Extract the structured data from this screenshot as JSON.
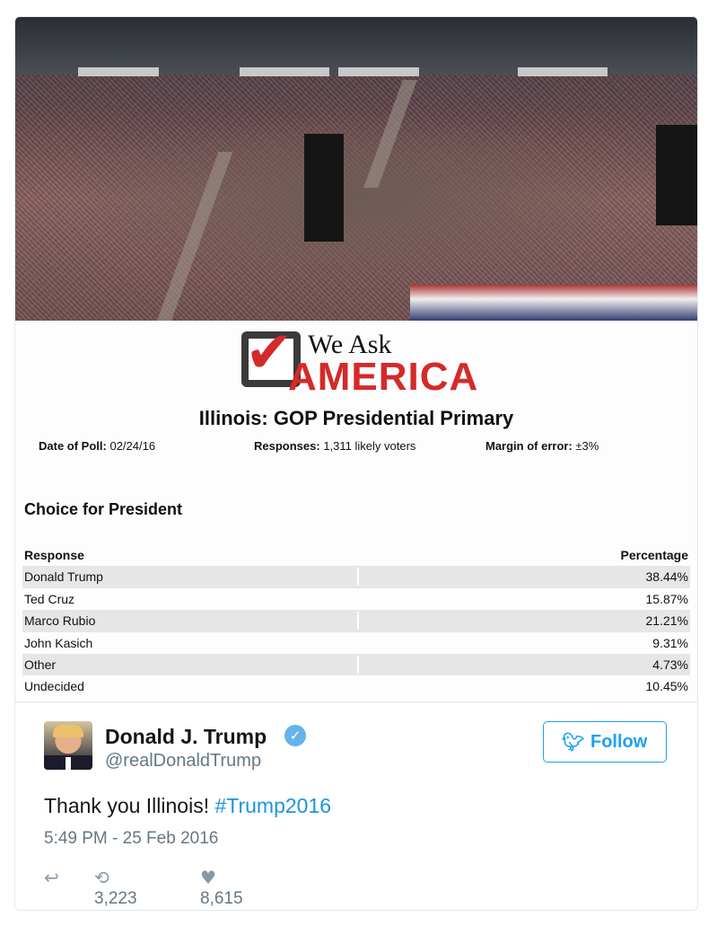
{
  "poll": {
    "logo_top": "We Ask",
    "logo_bottom": "AMERICA",
    "title": "Illinois: GOP Presidential Primary",
    "date_label": "Date of Poll:",
    "date_value": "02/24/16",
    "responses_label": "Responses:",
    "responses_value": "1,311 likely voters",
    "margin_label": "Margin of error:",
    "margin_value": "±3%",
    "section": "Choice for President",
    "columns": [
      "Response",
      "Percentage"
    ],
    "rows": [
      {
        "response": "Donald Trump",
        "percentage": "38.44%"
      },
      {
        "response": "Ted Cruz",
        "percentage": "15.87%"
      },
      {
        "response": "Marco Rubio",
        "percentage": "21.21%"
      },
      {
        "response": "John Kasich",
        "percentage": "9.31%"
      },
      {
        "response": "Other",
        "percentage": "4.73%"
      },
      {
        "response": "Undecided",
        "percentage": "10.45%"
      }
    ]
  },
  "tweet": {
    "display_name": "Donald J. Trump",
    "handle": "@realDonaldTrump",
    "follow_label": "Follow",
    "text": "Thank you Illinois! ",
    "hashtag": "#Trump2016",
    "timestamp": "5:49 PM - 25 Feb 2016",
    "retweets": "3,223",
    "likes": "8,615"
  },
  "icons": {
    "verified": "verified-badge-icon",
    "follow": "twitter-bird-icon",
    "reply": "reply-icon",
    "retweet": "retweet-icon",
    "like": "heart-icon"
  },
  "colors": {
    "twitter_blue": "#1da1f2",
    "hashtag": "#1b95e0",
    "logo_red": "#d42a2a",
    "muted": "#657786"
  }
}
